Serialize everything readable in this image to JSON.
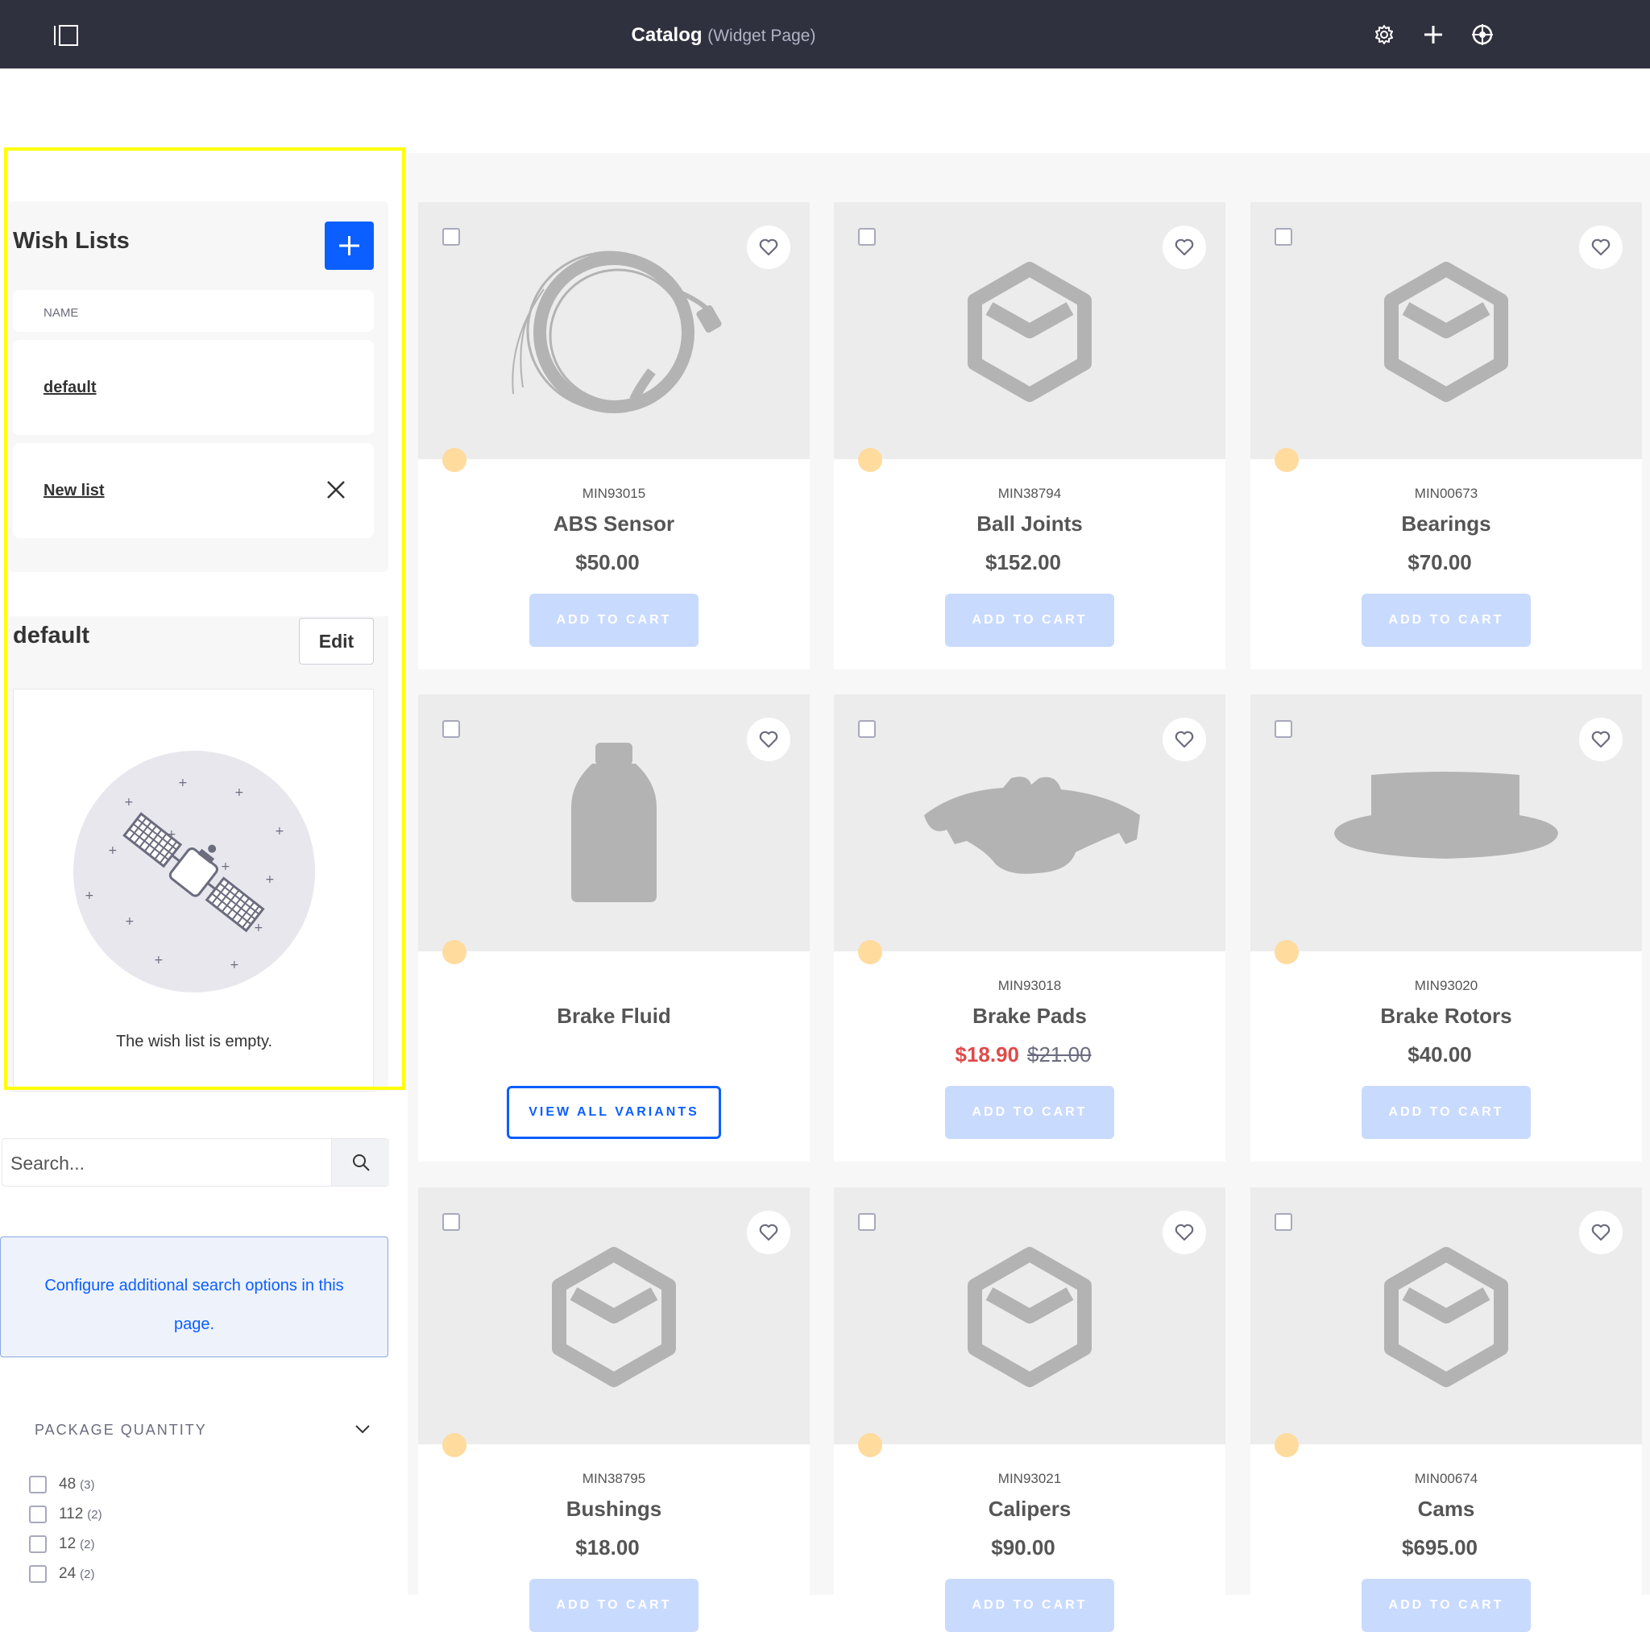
{
  "topbar": {
    "title": "Catalog",
    "subtitle": "(Widget Page)",
    "icons": [
      "sidebar-toggle-icon",
      "gear-icon",
      "plus-icon",
      "target-icon"
    ]
  },
  "wishlists": {
    "title": "Wish Lists",
    "column_header": "NAME",
    "items": [
      {
        "label": "default"
      },
      {
        "label": "New list"
      }
    ]
  },
  "current_list": {
    "title": "default",
    "edit_label": "Edit",
    "empty_message": "The wish list is empty."
  },
  "search": {
    "placeholder": "Search..."
  },
  "config": {
    "message": "Configure additional search options in this page."
  },
  "facet": {
    "title": "PACKAGE QUANTITY",
    "options": [
      {
        "value": "48",
        "count": "(3)"
      },
      {
        "value": "112",
        "count": "(2)"
      },
      {
        "value": "12",
        "count": "(2)"
      },
      {
        "value": "24",
        "count": "(2)"
      }
    ]
  },
  "products": [
    {
      "sku": "MIN93015",
      "name": "ABS Sensor",
      "price": "$50.00",
      "button": "ADD TO CART",
      "image": "cable-icon"
    },
    {
      "sku": "MIN38794",
      "name": "Ball Joints",
      "price": "$152.00",
      "button": "ADD TO CART",
      "image": "placeholder-box-icon"
    },
    {
      "sku": "MIN00673",
      "name": "Bearings",
      "price": "$70.00",
      "button": "ADD TO CART",
      "image": "placeholder-box-icon"
    },
    {
      "sku": "",
      "name": "Brake Fluid",
      "price": "",
      "button": "VIEW ALL VARIANTS",
      "image": "bottle-icon"
    },
    {
      "sku": "MIN93018",
      "name": "Brake Pads",
      "sale_price": "$18.90",
      "old_price": "$21.00",
      "button": "ADD TO CART",
      "image": "brake-pad-icon"
    },
    {
      "sku": "MIN93020",
      "name": "Brake Rotors",
      "price": "$40.00",
      "button": "ADD TO CART",
      "image": "rotor-icon"
    },
    {
      "sku": "MIN38795",
      "name": "Bushings",
      "price": "$18.00",
      "button": "ADD TO CART",
      "image": "placeholder-box-icon"
    },
    {
      "sku": "MIN93021",
      "name": "Calipers",
      "price": "$90.00",
      "button": "ADD TO CART",
      "image": "placeholder-box-icon"
    },
    {
      "sku": "MIN00674",
      "name": "Cams",
      "price": "$695.00",
      "button": "ADD TO CART",
      "image": "placeholder-box-icon"
    }
  ],
  "colors": {
    "topbar": "#30313f",
    "primary": "#0b5fff",
    "add_to_cart": "#c9daff",
    "sale_price": "#e04a4a",
    "highlight": "#ffff00"
  }
}
